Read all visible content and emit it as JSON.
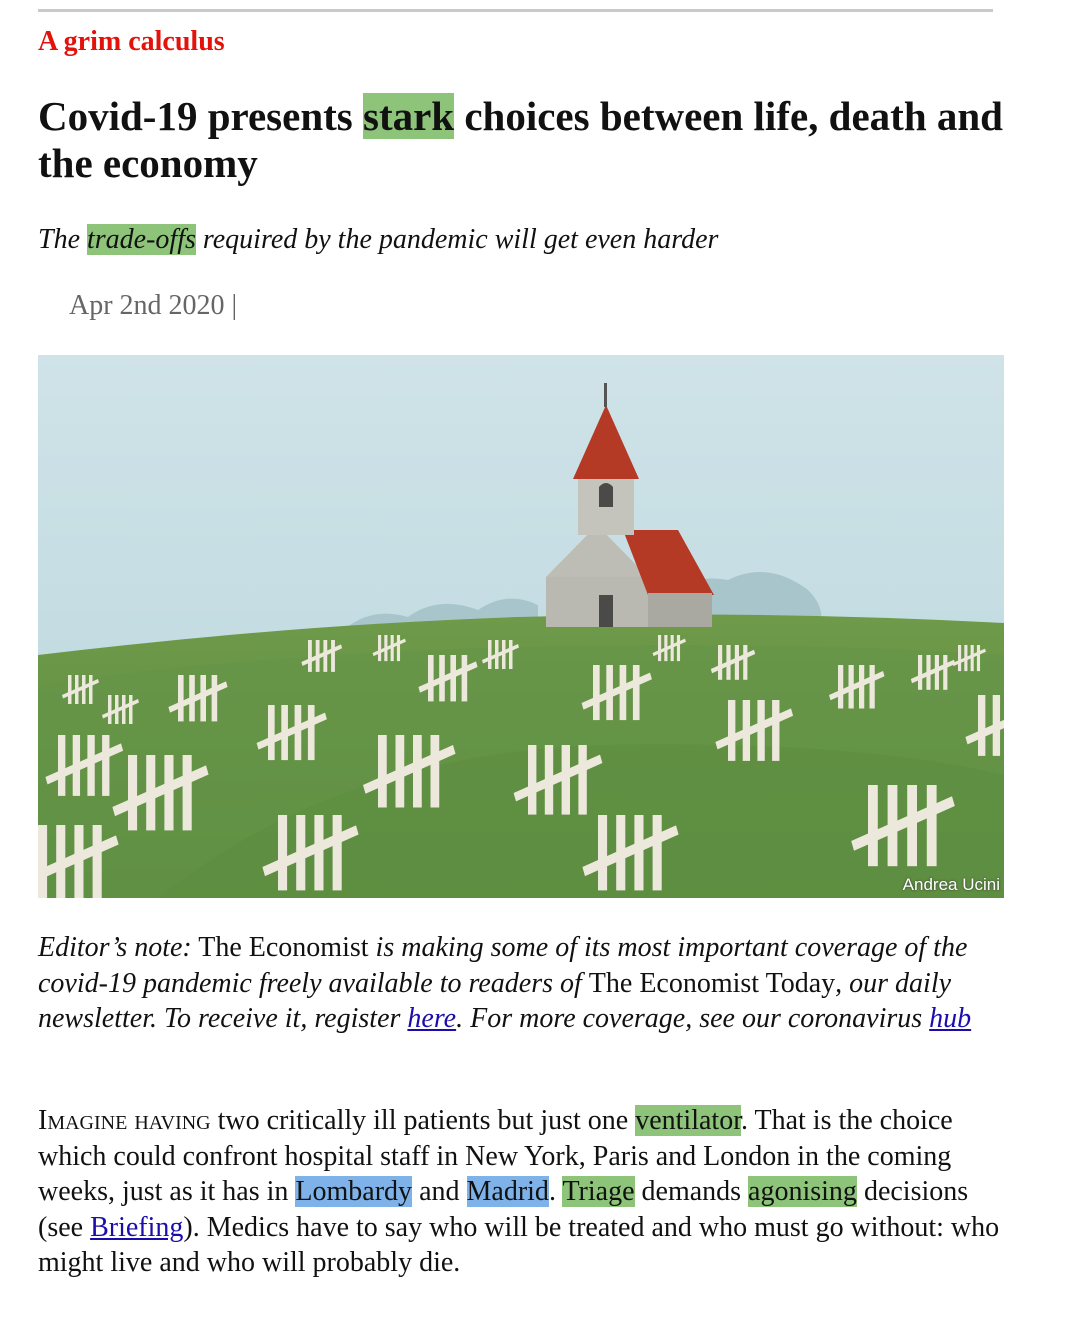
{
  "article": {
    "kicker": "A grim calculus",
    "headline": {
      "part1": "Covid-19 presents ",
      "highlight": "stark",
      "part2": " choices between life, death and the economy"
    },
    "standfirst": {
      "part1": "The ",
      "highlight": "trade-offs",
      "part2": " required by the pandemic will get even harder"
    },
    "date": "Apr 2nd 2020 |",
    "image": {
      "credit": "Andrea Ucini"
    },
    "editor_note": {
      "label": "Editor’s note:",
      "t1": " The Economist ",
      "t2": "is making some of its most important coverage of the covid-19 pandemic freely available to readers of ",
      "t3": "The Economist Today",
      "t4": ", our daily newsletter. To receive it, register ",
      "link_here": "here",
      "t5": ". For more coverage, see our coronavirus ",
      "link_hub": "hub"
    },
    "body": {
      "lead_caps": "Imagine having",
      "t1": " two critically ill patients but just one ",
      "hl_ventilator": "ventilator",
      "t2": ". That is the choice which could confront hospital staff in New York, Paris and London in the coming weeks, just as it has in ",
      "hl_lombardy": "Lombardy",
      "t3": " and ",
      "hl_madrid": "Madrid",
      "t4": ". ",
      "hl_triage": "Triage",
      "t5": " demands ",
      "hl_agonising": "agonising",
      "t6": " decisions (see ",
      "link_briefing": "Briefing",
      "t7": "). Medics have to say who will be treated and who must go without: who might live and who will probably die."
    }
  },
  "colors": {
    "kicker": "#e3120b",
    "highlight_green": "#8dc47a",
    "highlight_blue": "#7fb2e8",
    "link": "#1a0dab"
  }
}
